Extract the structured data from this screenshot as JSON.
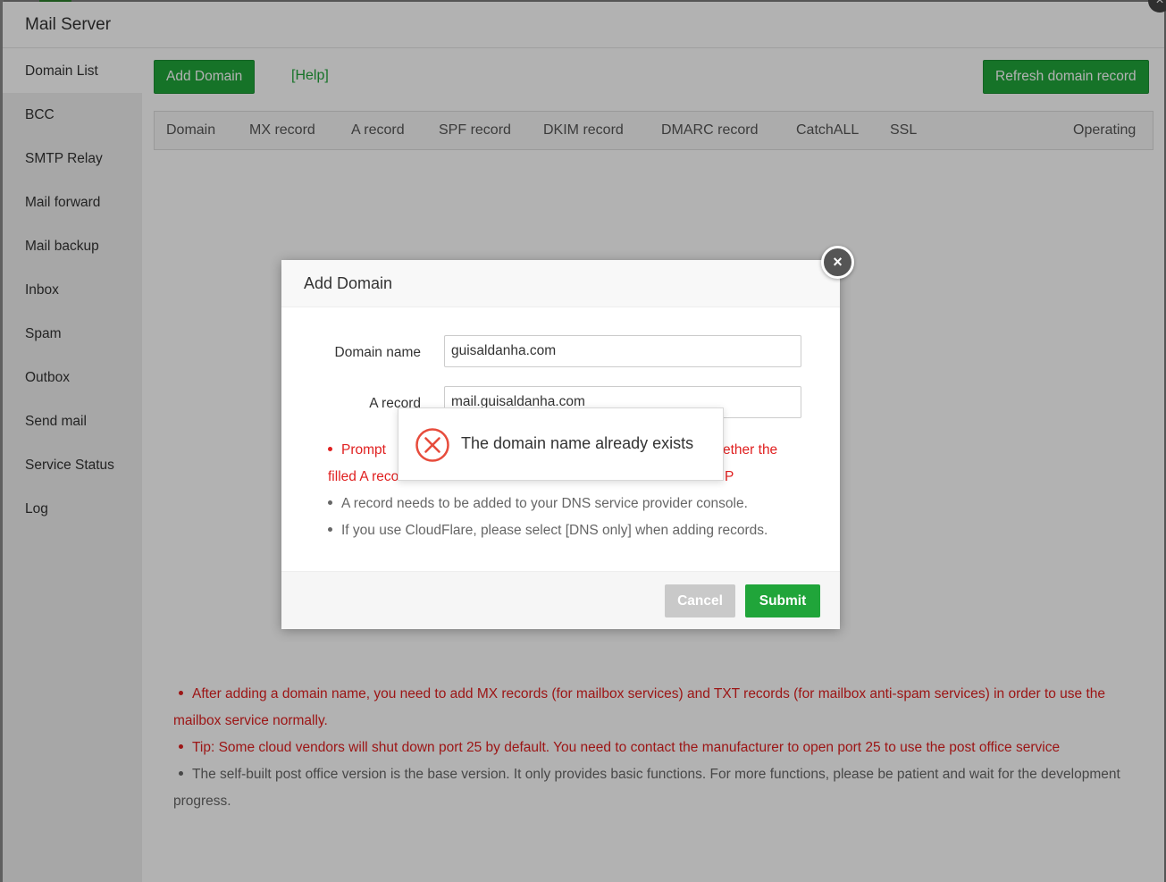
{
  "panel": {
    "title": "Mail Server",
    "close_icon": "×"
  },
  "sidebar": {
    "items": [
      {
        "label": "Domain List",
        "active": true
      },
      {
        "label": "BCC"
      },
      {
        "label": "SMTP Relay"
      },
      {
        "label": "Mail forward"
      },
      {
        "label": "Mail backup"
      },
      {
        "label": "Inbox"
      },
      {
        "label": "Spam"
      },
      {
        "label": "Outbox"
      },
      {
        "label": "Send mail"
      },
      {
        "label": "Service Status"
      },
      {
        "label": "Log"
      }
    ]
  },
  "toolbar": {
    "add_domain_label": "Add Domain",
    "help_label": "[Help]",
    "refresh_label": "Refresh domain record"
  },
  "table": {
    "columns": [
      "Domain",
      "MX record",
      "A record",
      "SPF record",
      "DKIM record",
      "DMARC record",
      "CatchALL",
      "SSL",
      "Operating"
    ]
  },
  "notes": [
    {
      "text": "After adding a domain name, you need to add MX records (for mailbox services) and TXT records (for mailbox anti-spam services) in order to use the mailbox service normally.",
      "color": "red"
    },
    {
      "text": "Tip: Some cloud vendors will shut down port 25 by default. You need to contact the manufacturer to open port 25 to use the post office service",
      "color": "red"
    },
    {
      "text": "The self-built post office version is the base version. It only provides basic functions. For more functions, please be patient and wait for the development progress.",
      "color": "grey"
    }
  ],
  "modal": {
    "title": "Add Domain",
    "close_icon": "×",
    "domain_label": "Domain name",
    "domain_value": "guisaldanha.com",
    "a_record_label": "A record",
    "a_record_value": "mail.guisaldanha.com",
    "tips": [
      {
        "text_before": "Prompt",
        "text_after": "ether the",
        "line2": "filled A reco",
        "line2_after": "P",
        "color": "red"
      },
      {
        "text": "A record needs to be added to your DNS service provider console.",
        "color": "grey"
      },
      {
        "text": "If you use CloudFlare, please select [DNS only] when adding records.",
        "color": "grey"
      }
    ],
    "cancel_label": "Cancel",
    "submit_label": "Submit"
  },
  "toast": {
    "icon": "error-circle-icon",
    "message": "The domain name already exists"
  },
  "colors": {
    "accent": "#20a53a",
    "error": "#e02020"
  }
}
